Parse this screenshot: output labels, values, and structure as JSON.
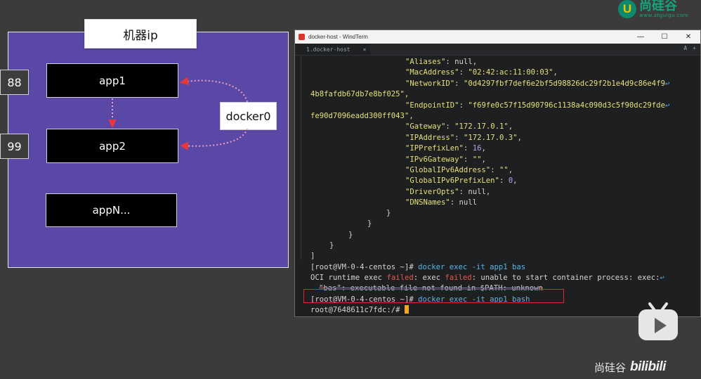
{
  "diagram": {
    "machine_title": "机器ip",
    "apps": [
      "app1",
      "app2",
      "appN..."
    ],
    "ports": [
      "88",
      "99"
    ],
    "bridge": "docker0"
  },
  "logo": {
    "cn": "尚硅谷",
    "en": "www.atguigu.com",
    "mark": "U"
  },
  "window": {
    "title": "docker-host - WindTerm",
    "tab": "1.docker-host",
    "tab_close": "×",
    "tools": [
      "A",
      "+"
    ],
    "controls": [
      "—",
      "☐",
      "✕"
    ]
  },
  "terminal": {
    "json_lines": [
      {
        "key": "\"Aliases\"",
        "sep": ": ",
        "val": "null",
        "type": "p",
        "end": ","
      },
      {
        "key": "\"MacAddress\"",
        "sep": ": ",
        "val": "\"02:42:ac:11:00:03\"",
        "type": "s",
        "end": ","
      },
      {
        "key": "\"NetworkID\"",
        "sep": ": ",
        "val": "\"0d4297fbf7def6e2bf5d98826dc29f2b1e4d9c86e4f9",
        "type": "s",
        "end": ""
      },
      {
        "cont": "4b8fafdb67db7e8bf025\","
      },
      {
        "key": "\"EndpointID\"",
        "sep": ": ",
        "val": "\"f69fe0c57f15d90796c1138a4c090d3c5f90dc29fde",
        "type": "s",
        "end": ""
      },
      {
        "cont": "fe90d7096eadd300ff043\","
      },
      {
        "key": "\"Gateway\"",
        "sep": ": ",
        "val": "\"172.17.0.1\"",
        "type": "s",
        "end": ","
      },
      {
        "key": "\"IPAddress\"",
        "sep": ": ",
        "val": "\"172.17.0.3\"",
        "type": "s",
        "end": ","
      },
      {
        "key": "\"IPPrefixLen\"",
        "sep": ": ",
        "val": "16",
        "type": "n",
        "end": ","
      },
      {
        "key": "\"IPv6Gateway\"",
        "sep": ": ",
        "val": "\"\"",
        "type": "s",
        "end": ","
      },
      {
        "key": "\"GlobalIPv6Address\"",
        "sep": ": ",
        "val": "\"\"",
        "type": "s",
        "end": ","
      },
      {
        "key": "\"GlobalIPv6PrefixLen\"",
        "sep": ": ",
        "val": "0",
        "type": "n",
        "end": ","
      },
      {
        "key": "\"DriverOpts\"",
        "sep": ": ",
        "val": "null",
        "type": "p",
        "end": ","
      },
      {
        "key": "\"DNSNames\"",
        "sep": ": ",
        "val": "null",
        "type": "p",
        "end": ""
      }
    ],
    "braces": [
      "}",
      "}",
      "}",
      "}",
      "]"
    ],
    "prompt": "[root@VM-0-4-centos ~]#",
    "cmd1": "docker exec -it app1 bas",
    "err1_a": "OCI runtime exec ",
    "err1_failed": "failed",
    "err1_b": ": exec ",
    "err1_failed2": "failed",
    "err1_c": ": unable to start container process: exec:",
    "err2": "\"bas\": executable file not found in $PATH: unknown",
    "cmd2": "docker exec -it app1 bash",
    "prompt2": "root@7648611c7fdc:/#",
    "wrap_glyph": "↩"
  },
  "watermark": {
    "cn": "尚硅谷",
    "brand": "bilibili"
  }
}
